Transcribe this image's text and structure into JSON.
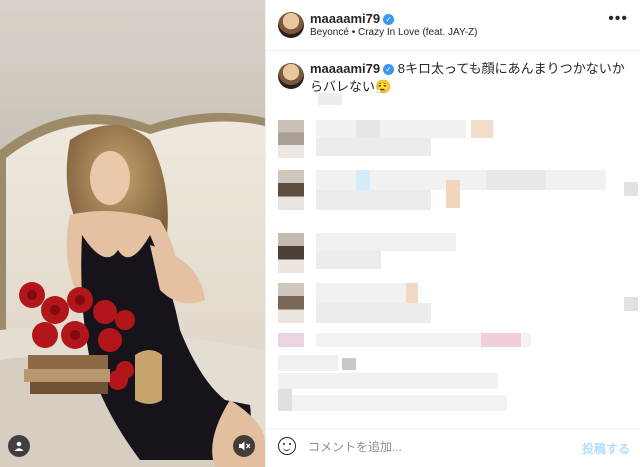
{
  "post": {
    "username": "maaaami79",
    "audio": "Beyoncé • Crazy In Love (feat. JAY-Z)",
    "caption_user": "maaaami79",
    "caption_text": "8キロ太っても顔にあんまりつかないからバレない",
    "caption_emoji": "😮‍💨"
  },
  "icons": {
    "verified": "verified-badge-icon",
    "more": "more-options-icon",
    "emoji": "emoji-icon",
    "user_tag": "user-tag-icon",
    "mute": "muted-speaker-icon"
  },
  "footer": {
    "comment_placeholder": "コメントを追加...",
    "post_label": "投稿する"
  },
  "colors": {
    "accent": "#3897f0",
    "post_disabled": "#b2dffc"
  }
}
